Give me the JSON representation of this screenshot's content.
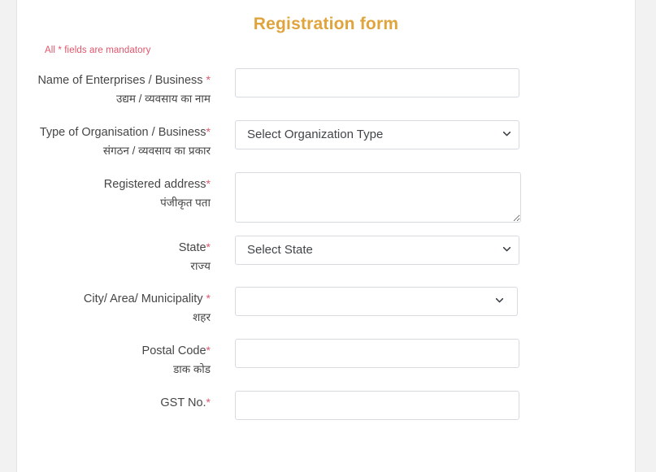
{
  "form": {
    "title": "Registration form",
    "mandatory_note": "All * fields are mandatory",
    "required_marker": "*",
    "colors": {
      "title": "#e0a43c",
      "required": "#e2566c",
      "label": "#464646",
      "border": "#d7dbdf",
      "note": "#e0556b"
    },
    "fields": [
      {
        "name": "enterprise-name",
        "label_en": "Name of Enterprises / Business",
        "label_hi": "उद्यम / व्यवसाय का नाम",
        "required": true,
        "control": "text",
        "value": "",
        "placeholder": ""
      },
      {
        "name": "organisation-type",
        "label_en": "Type of Organisation / Business",
        "label_hi": "संगठन / व्यवसाय का प्रकार",
        "required": true,
        "control": "select",
        "selected": "Select Organization Type",
        "icon": "chevron-down-icon"
      },
      {
        "name": "registered-address",
        "label_en": "Registered address",
        "label_hi": "पंजीकृत पता",
        "required": true,
        "control": "textarea",
        "value": "",
        "placeholder": ""
      },
      {
        "name": "state",
        "label_en": "State",
        "label_hi": "राज्य",
        "required": true,
        "control": "select",
        "selected": "Select State",
        "icon": "chevron-down-icon"
      },
      {
        "name": "city-area-municipality",
        "label_en": "City/ Area/ Municipality",
        "label_hi": "शहर",
        "required": true,
        "control": "select",
        "selected": "",
        "icon": "chevron-down-icon"
      },
      {
        "name": "postal-code",
        "label_en": "Postal Code",
        "label_hi": "डाक कोड",
        "required": true,
        "control": "text",
        "value": "",
        "placeholder": ""
      },
      {
        "name": "gst-no",
        "label_en": "GST No.",
        "label_hi": "",
        "required": true,
        "control": "text",
        "value": "",
        "placeholder": ""
      }
    ]
  }
}
